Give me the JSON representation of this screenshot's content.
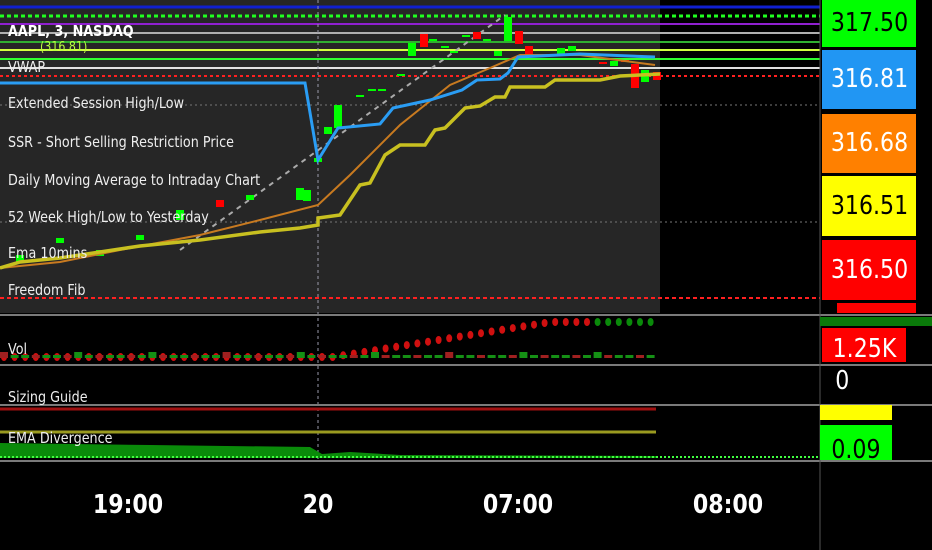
{
  "symbol": "AAPL, 3, NASDAQ",
  "legend": [
    "VWAP",
    "Extended Session High/Low",
    "SSR - Short Selling Restriction Price",
    "Daily Moving Average to Intraday Chart",
    "52 Week High/Low to Yesterday",
    "Ema 10mins",
    "Freedom Fib"
  ],
  "overlay_price": "(316.81)",
  "price_labels": [
    {
      "value": "317.50",
      "bg": "#00ff00",
      "fg": "#000000"
    },
    {
      "value": "316.81",
      "bg": "#2196f3",
      "fg": "#ffffff"
    },
    {
      "value": "316.68",
      "bg": "#ff8000",
      "fg": "#ffffff"
    },
    {
      "value": "316.51",
      "bg": "#ffff00",
      "fg": "#000000"
    },
    {
      "value": "316.50",
      "bg": "#ff0000",
      "fg": "#ffffff"
    }
  ],
  "panels": {
    "volume": {
      "label": "Vol",
      "value": "1.25K"
    },
    "sizing": {
      "label": "Sizing Guide",
      "value": "0"
    },
    "ema_divergence": {
      "label": "EMA Divergence",
      "value": "0.09"
    }
  },
  "time_axis": [
    "19:00",
    "20",
    "07:00",
    "08:00"
  ],
  "colors": {
    "vwap": "#2a9df4",
    "ema": "#c87a20",
    "step": "#c8c020",
    "up": "#00ff00",
    "down": "#ff0000"
  }
}
